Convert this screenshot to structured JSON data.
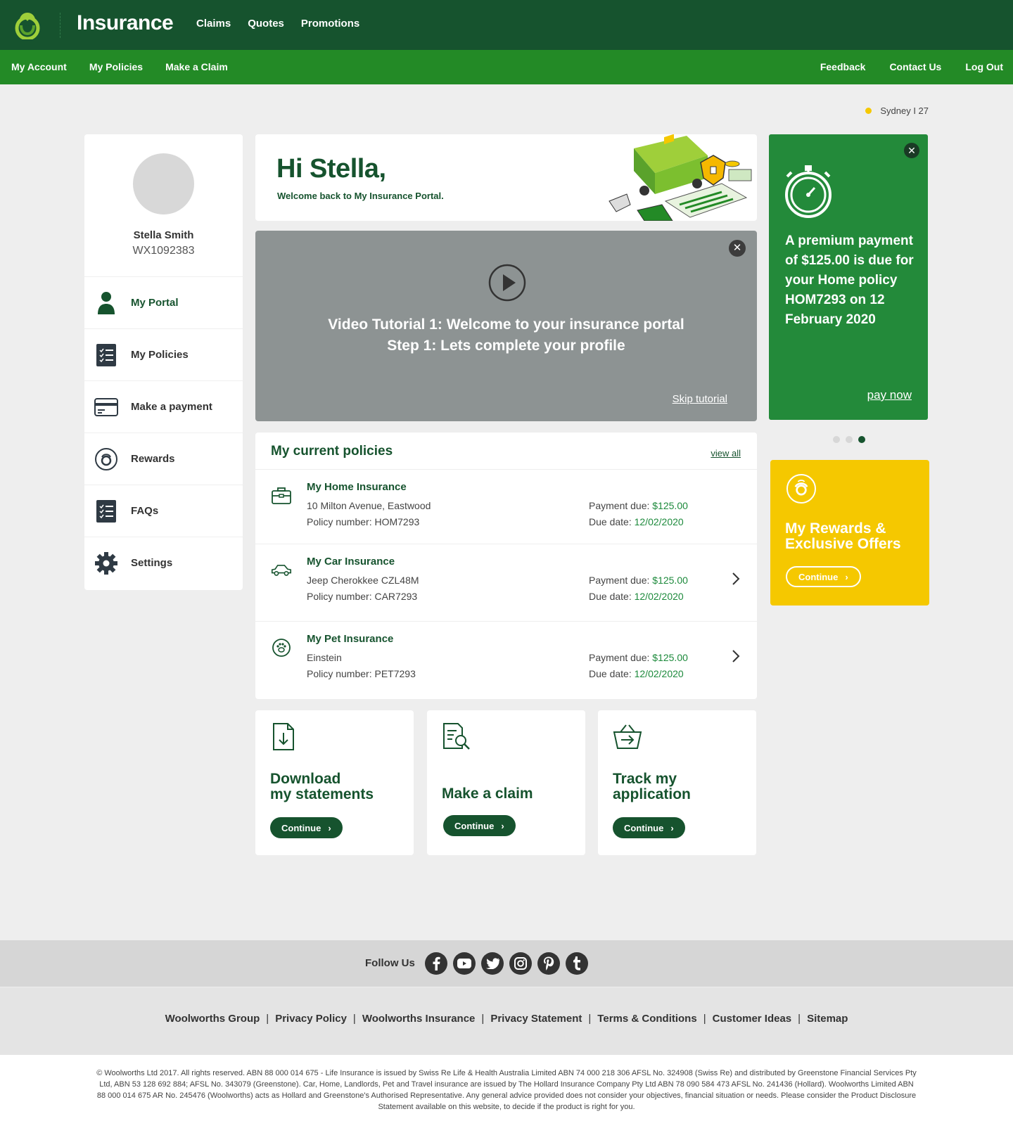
{
  "header": {
    "brand": "Insurance",
    "nav": [
      "Claims",
      "Quotes",
      "Promotions"
    ]
  },
  "subnav": {
    "left": [
      "My Account",
      "My Policies",
      "Make a Claim"
    ],
    "right": [
      "Feedback",
      "Contact Us",
      "Log Out"
    ]
  },
  "weather": {
    "text": "Sydney I 27"
  },
  "profile": {
    "name": "Stella Smith",
    "id": "WX1092383",
    "menu": [
      {
        "label": "My Portal",
        "icon": "person-icon"
      },
      {
        "label": "My Policies",
        "icon": "checklist-icon"
      },
      {
        "label": "Make a payment",
        "icon": "credit-card-icon"
      },
      {
        "label": "Rewards",
        "icon": "rewards-icon"
      },
      {
        "label": "FAQs",
        "icon": "checklist-icon"
      },
      {
        "label": "Settings",
        "icon": "gear-icon"
      }
    ]
  },
  "greeting": {
    "title": "Hi Stella,",
    "subtitle": "Welcome back to My Insurance Portal."
  },
  "video": {
    "line1": "Video Tutorial 1: Welcome to your insurance portal",
    "line2": "Step 1: Lets complete your profile",
    "skip": "Skip tutorial"
  },
  "policies": {
    "title": "My current policies",
    "view_all": "view all",
    "payment_label": "Payment due:",
    "due_label": "Due date:",
    "items": [
      {
        "title": "My Home Insurance",
        "line1": "10 Milton Avenue, Eastwood",
        "line2": "Policy number: HOM7293",
        "payment": "$125.00",
        "due": "12/02/2020",
        "icon": "briefcase-icon"
      },
      {
        "title": "My Car Insurance",
        "line1": "Jeep Cherokkee CZL48M",
        "line2": "Policy number: CAR7293",
        "payment": "$125.00",
        "due": "12/02/2020",
        "icon": "car-icon"
      },
      {
        "title": "My Pet Insurance",
        "line1": "Einstein",
        "line2": "Policy number: PET7293",
        "payment": "$125.00",
        "due": "12/02/2020",
        "icon": "paw-icon"
      }
    ]
  },
  "actions": [
    {
      "line1": "Download",
      "line2": "my statements",
      "button": "Continue",
      "icon": "download-document-icon"
    },
    {
      "line1": "Make a claim",
      "line2": "",
      "button": "Continue",
      "icon": "search-document-icon"
    },
    {
      "line1": "Track my",
      "line2": "application",
      "button": "Continue",
      "icon": "basket-arrow-icon"
    }
  ],
  "payment": {
    "pre": "A premium payment of",
    "amount": "$125.00",
    "mid": "is due for your Home policy HOM7293 on",
    "date": "12 February 2020",
    "pay_now": "pay now"
  },
  "carousel": {
    "count": 3,
    "active": 3
  },
  "rewards": {
    "line1": "My Rewards &",
    "line2": "Exclusive Offers",
    "button": "Continue"
  },
  "footer": {
    "follow": "Follow Us",
    "socials": [
      "facebook-icon",
      "youtube-icon",
      "twitter-icon",
      "instagram-icon",
      "pinterest-icon",
      "tumblr-icon"
    ],
    "links": [
      "Woolworths Group",
      "Privacy Policy",
      "Woolworths Insurance",
      "Privacy Statement",
      "Terms & Conditions",
      "Customer Ideas",
      "Sitemap"
    ],
    "legal": "© Woolworths Ltd 2017. All rights reserved. ABN 88 000 014 675 - Life Insurance is issued by Swiss Re Life & Health Australia Limited ABN 74 000 218 306 AFSL No. 324908 (Swiss Re) and distributed by Greenstone Financial Services Pty Ltd, ABN 53 128 692 884; AFSL No. 343079 (Greenstone). Car, Home, Landlords, Pet and Travel insurance are issued by The Hollard Insurance Company Pty Ltd ABN 78 090 584 473 AFSL No. 241436 (Hollard). Woolworths Limited ABN 88 000 014 675 AR No. 245476 (Woolworths) acts as Hollard and Greenstone's Authorised Representative. Any general advice provided does not consider your objectives, financial situation or needs. Please consider the Product Disclosure Statement available on this website, to decide if the product is right for you."
  },
  "colors": {
    "header_dark_green": "#16532e",
    "nav_green": "#238a26",
    "payment_green": "#238a3a",
    "rewards_yellow": "#f5c800",
    "accent_text_green": "#1d8a3c"
  }
}
